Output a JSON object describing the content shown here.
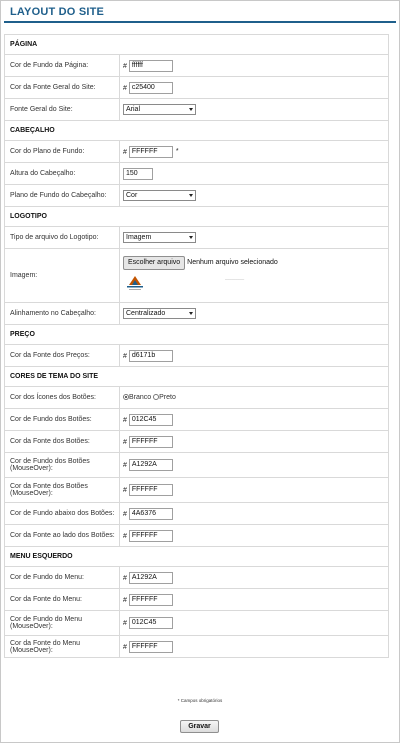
{
  "page": {
    "title": "LAYOUT DO SITE"
  },
  "sections": {
    "pagina": "PÁGINA",
    "cabecalho": "CABEÇALHO",
    "logotipo": "LOGOTIPO",
    "preco": "PREÇO",
    "cores_tema": "CORES DE TEMA DO SITE",
    "menu_esquerdo": "MENU ESQUERDO"
  },
  "hash": "#",
  "required_marker": "*",
  "pagina": {
    "bg_label": "Cor de Fundo da Página:",
    "bg_value": "ffffff",
    "font_color_label": "Cor da Fonte Geral do Site:",
    "font_color_value": "c25400",
    "font_label": "Fonte Geral do Site:",
    "font_value": "Arial"
  },
  "cabecalho": {
    "bg_label": "Cor do Plano de Fundo:",
    "bg_value": "FFFFFF",
    "height_label": "Altura do Cabeçalho:",
    "height_value": "150",
    "bg_type_label": "Plano de Fundo do Cabeçalho:",
    "bg_type_value": "Cor"
  },
  "logotipo": {
    "type_label": "Tipo de arquivo do Logotipo:",
    "type_value": "Imagem",
    "image_label": "Imagem:",
    "file_button": "Escolher arquivo",
    "file_status": "Nenhum arquivo selecionado",
    "align_label": "Alinhamento no Cabeçalho:",
    "align_value": "Centralizado"
  },
  "preco": {
    "font_color_label": "Cor da Fonte dos Preços:",
    "font_color_value": "d6171b"
  },
  "cores_tema": {
    "icons_label": "Cor dos Ícones dos Botões:",
    "icons_option_white": "Branco",
    "icons_option_black": "Preto",
    "icons_selected": "Branco",
    "btn_bg_label": "Cor de Fundo dos Botões:",
    "btn_bg_value": "012C45",
    "btn_font_label": "Cor da Fonte dos Botões:",
    "btn_font_value": "FFFFFF",
    "btn_bg_hover_label": "Cor de Fundo dos Botões (MouseOver):",
    "btn_bg_hover_value": "A1292A",
    "btn_font_hover_label": "Cor da Fonte dos Botões (MouseOver):",
    "btn_font_hover_value": "FFFFFF",
    "below_bg_label": "Cor de Fundo abaixo dos Botões:",
    "below_bg_value": "4A6376",
    "side_font_label": "Cor da Fonte ao lado dos Botões:",
    "side_font_value": "FFFFFF"
  },
  "menu_esquerdo": {
    "bg_label": "Cor de Fundo do Menu:",
    "bg_value": "A1292A",
    "font_label": "Cor da Fonte do Menu:",
    "font_value": "FFFFFF",
    "bg_hover_label": "Cor de Fundo do Menu (MouseOver):",
    "bg_hover_value": "012C45",
    "font_hover_label": "Cor da Fonte do Menu (MouseOver):",
    "font_hover_value": "FFFFFF"
  },
  "footer": {
    "required_note": "* Campos obrigatórios",
    "save_label": "Gravar"
  },
  "colors": {
    "title": "#1f5f8b",
    "border": "#d9d9d9"
  }
}
